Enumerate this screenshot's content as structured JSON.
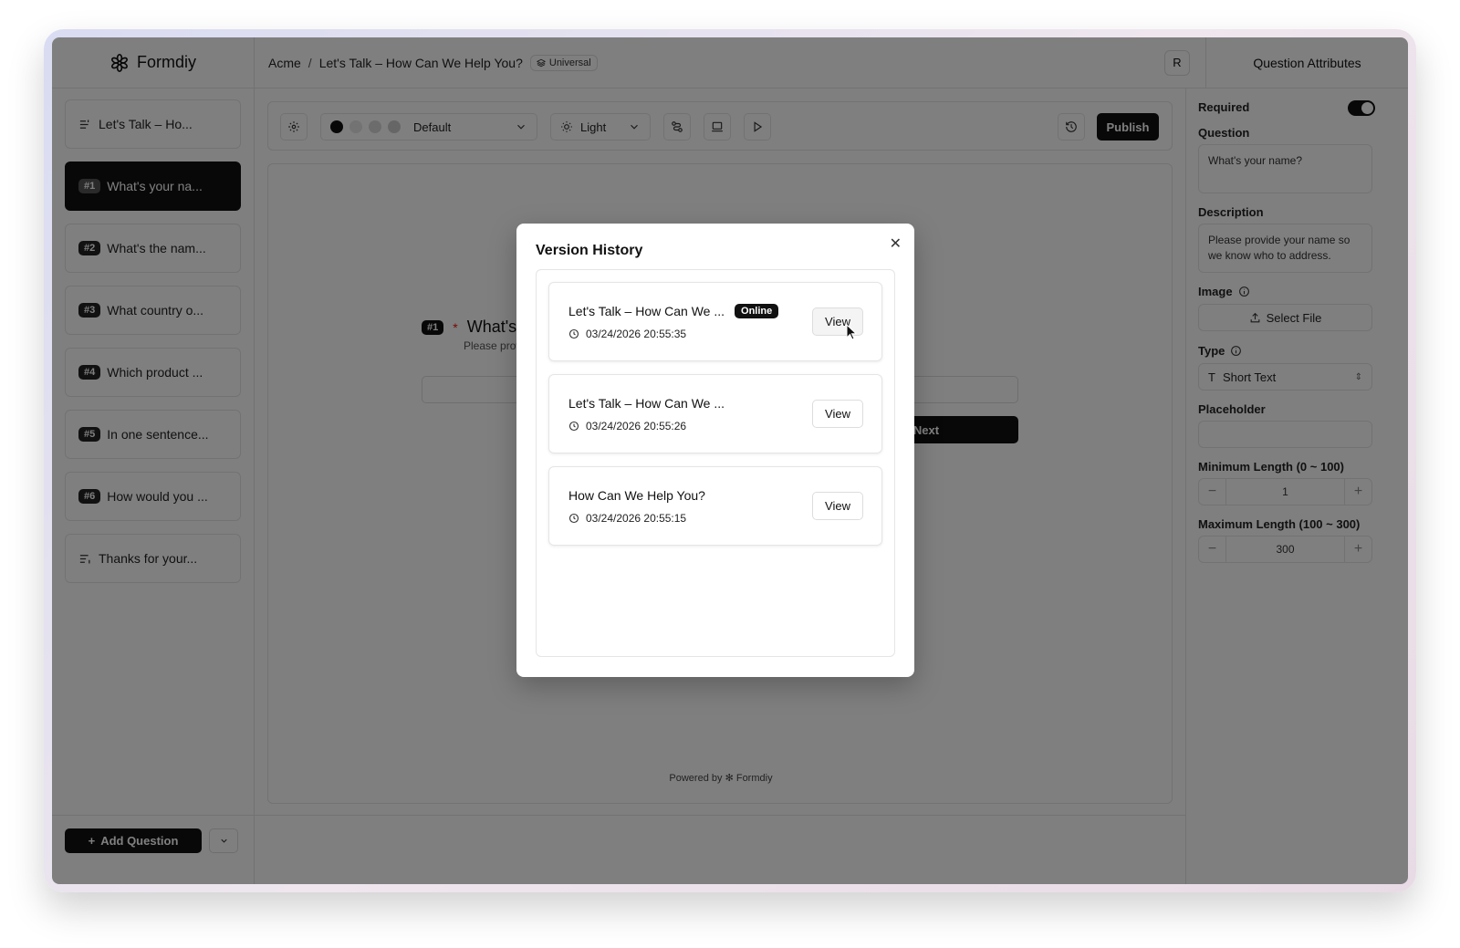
{
  "brand": {
    "name": "Formdiy"
  },
  "breadcrumb": {
    "workspace": "Acme",
    "separator": "/",
    "form": "Let's Talk – How Can We Help You?",
    "badge": "Universal"
  },
  "user": {
    "initial": "R"
  },
  "right_panel_title": "Question Attributes",
  "sidebar": {
    "items": [
      {
        "num": "",
        "label": "Let's Talk – Ho..."
      },
      {
        "num": "#1",
        "label": "What's your na..."
      },
      {
        "num": "#2",
        "label": "What's the nam..."
      },
      {
        "num": "#3",
        "label": "What country o..."
      },
      {
        "num": "#4",
        "label": "Which product ..."
      },
      {
        "num": "#5",
        "label": "In one sentence..."
      },
      {
        "num": "#6",
        "label": "How would you ..."
      },
      {
        "num": "",
        "label": "Thanks for your..."
      }
    ],
    "add_label": "Add Question"
  },
  "toolbar": {
    "theme": "Default",
    "mode": "Light",
    "publish": "Publish",
    "theme_colors": [
      "#111111",
      "#e6e6e6",
      "#d9d9d9",
      "#cccccc"
    ]
  },
  "preview": {
    "num": "#1",
    "required_mark": "*",
    "question": "What's your name?",
    "description": "Please provide your name so we know who to address.",
    "next": "Next",
    "powered_prefix": "Powered by",
    "powered_brand": "Formdiy"
  },
  "attributes": {
    "required_label": "Required",
    "question_label": "Question",
    "question_value": "What's your name?",
    "description_label": "Description",
    "description_value": "Please provide your name so we know who to address.",
    "image_label": "Image",
    "select_file": "Select File",
    "type_label": "Type",
    "type_value": "Short Text",
    "placeholder_label": "Placeholder",
    "placeholder_value": "",
    "min_label": "Minimum Length (0 ~ 100)",
    "min_value": "1",
    "max_label": "Maximum Length (100 ~ 300)",
    "max_value": "300"
  },
  "modal": {
    "title": "Version History",
    "versions": [
      {
        "title": "Let's Talk – How Can We ...",
        "badge": "Online",
        "time": "03/24/2026 20:55:35",
        "action": "View"
      },
      {
        "title": "Let's Talk – How Can We ...",
        "badge": "",
        "time": "03/24/2026 20:55:26",
        "action": "View"
      },
      {
        "title": "How Can We Help You?",
        "badge": "",
        "time": "03/24/2026 20:55:15",
        "action": "View"
      }
    ]
  }
}
